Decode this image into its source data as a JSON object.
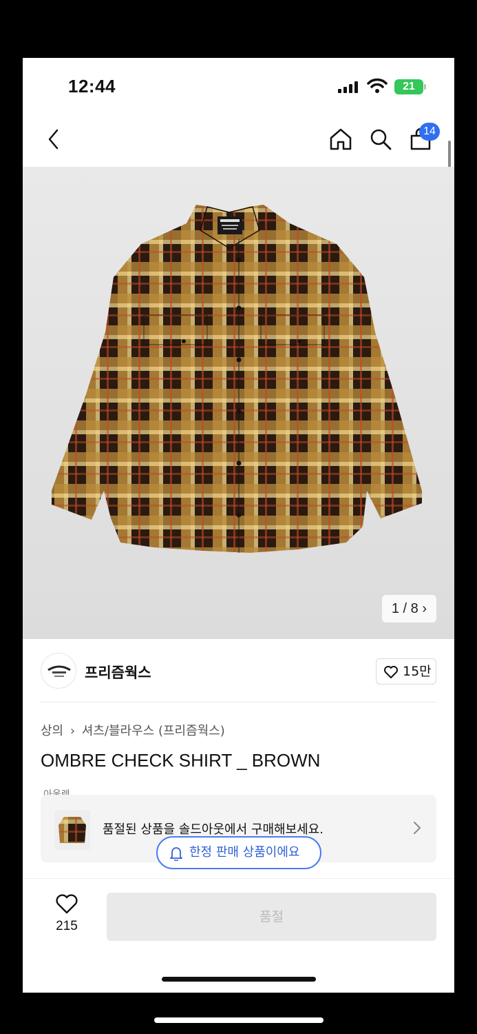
{
  "status": {
    "time": "12:44",
    "battery": "21"
  },
  "nav": {
    "cart_count": "14"
  },
  "gallery": {
    "counter": "1 / 8",
    "counter_arrow": "›"
  },
  "brand": {
    "name": "프리즘웍스",
    "likes": "15만"
  },
  "breadcrumb": {
    "category": "상의",
    "separator": "›",
    "subcategory": "셔츠/블라우스 (프리즘웍스)"
  },
  "product": {
    "title": "OMBRE CHECK SHIRT _ BROWN",
    "partial_tag": "아울렛"
  },
  "soldout_banner": {
    "text": "품절된 상품을 솔드아웃에서 구매해보세요."
  },
  "limited": {
    "text": "한정 판매 상품이에요"
  },
  "bottom": {
    "wish_count": "215",
    "action_label": "품절"
  },
  "colors": {
    "accent": "#2f6ff0",
    "battery": "#34c759",
    "disabled": "#e9e9e9"
  }
}
